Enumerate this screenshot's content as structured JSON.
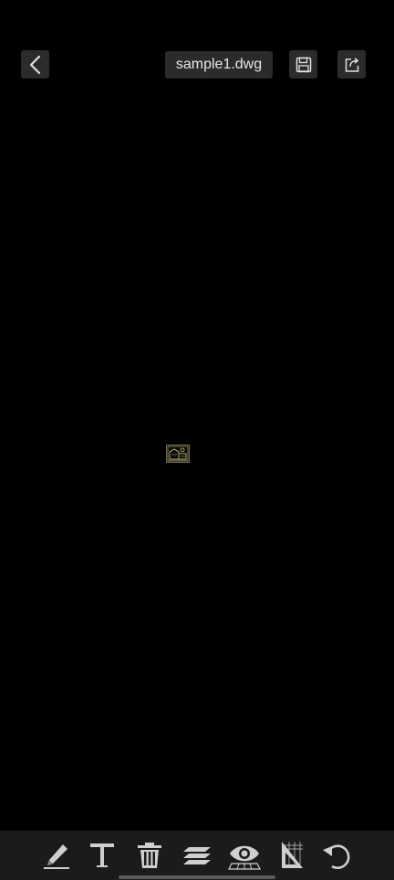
{
  "header": {
    "filename": "sample1.dwg"
  },
  "icons": {
    "back": "chevron-left-icon",
    "save": "floppy-disk-icon",
    "share": "share-export-icon",
    "markup": "pen-icon",
    "text": "text-icon",
    "delete": "trash-icon",
    "layers": "layers-icon",
    "view": "eye-icon",
    "measure": "ruler-triangle-icon",
    "undo": "undo-icon"
  },
  "colors": {
    "background": "#000000",
    "button_bg": "#2b2b2b",
    "toolbar_bg": "#1b1b1b",
    "icon": "#d0d0d0",
    "drawing_yellow": "#d8c870"
  }
}
